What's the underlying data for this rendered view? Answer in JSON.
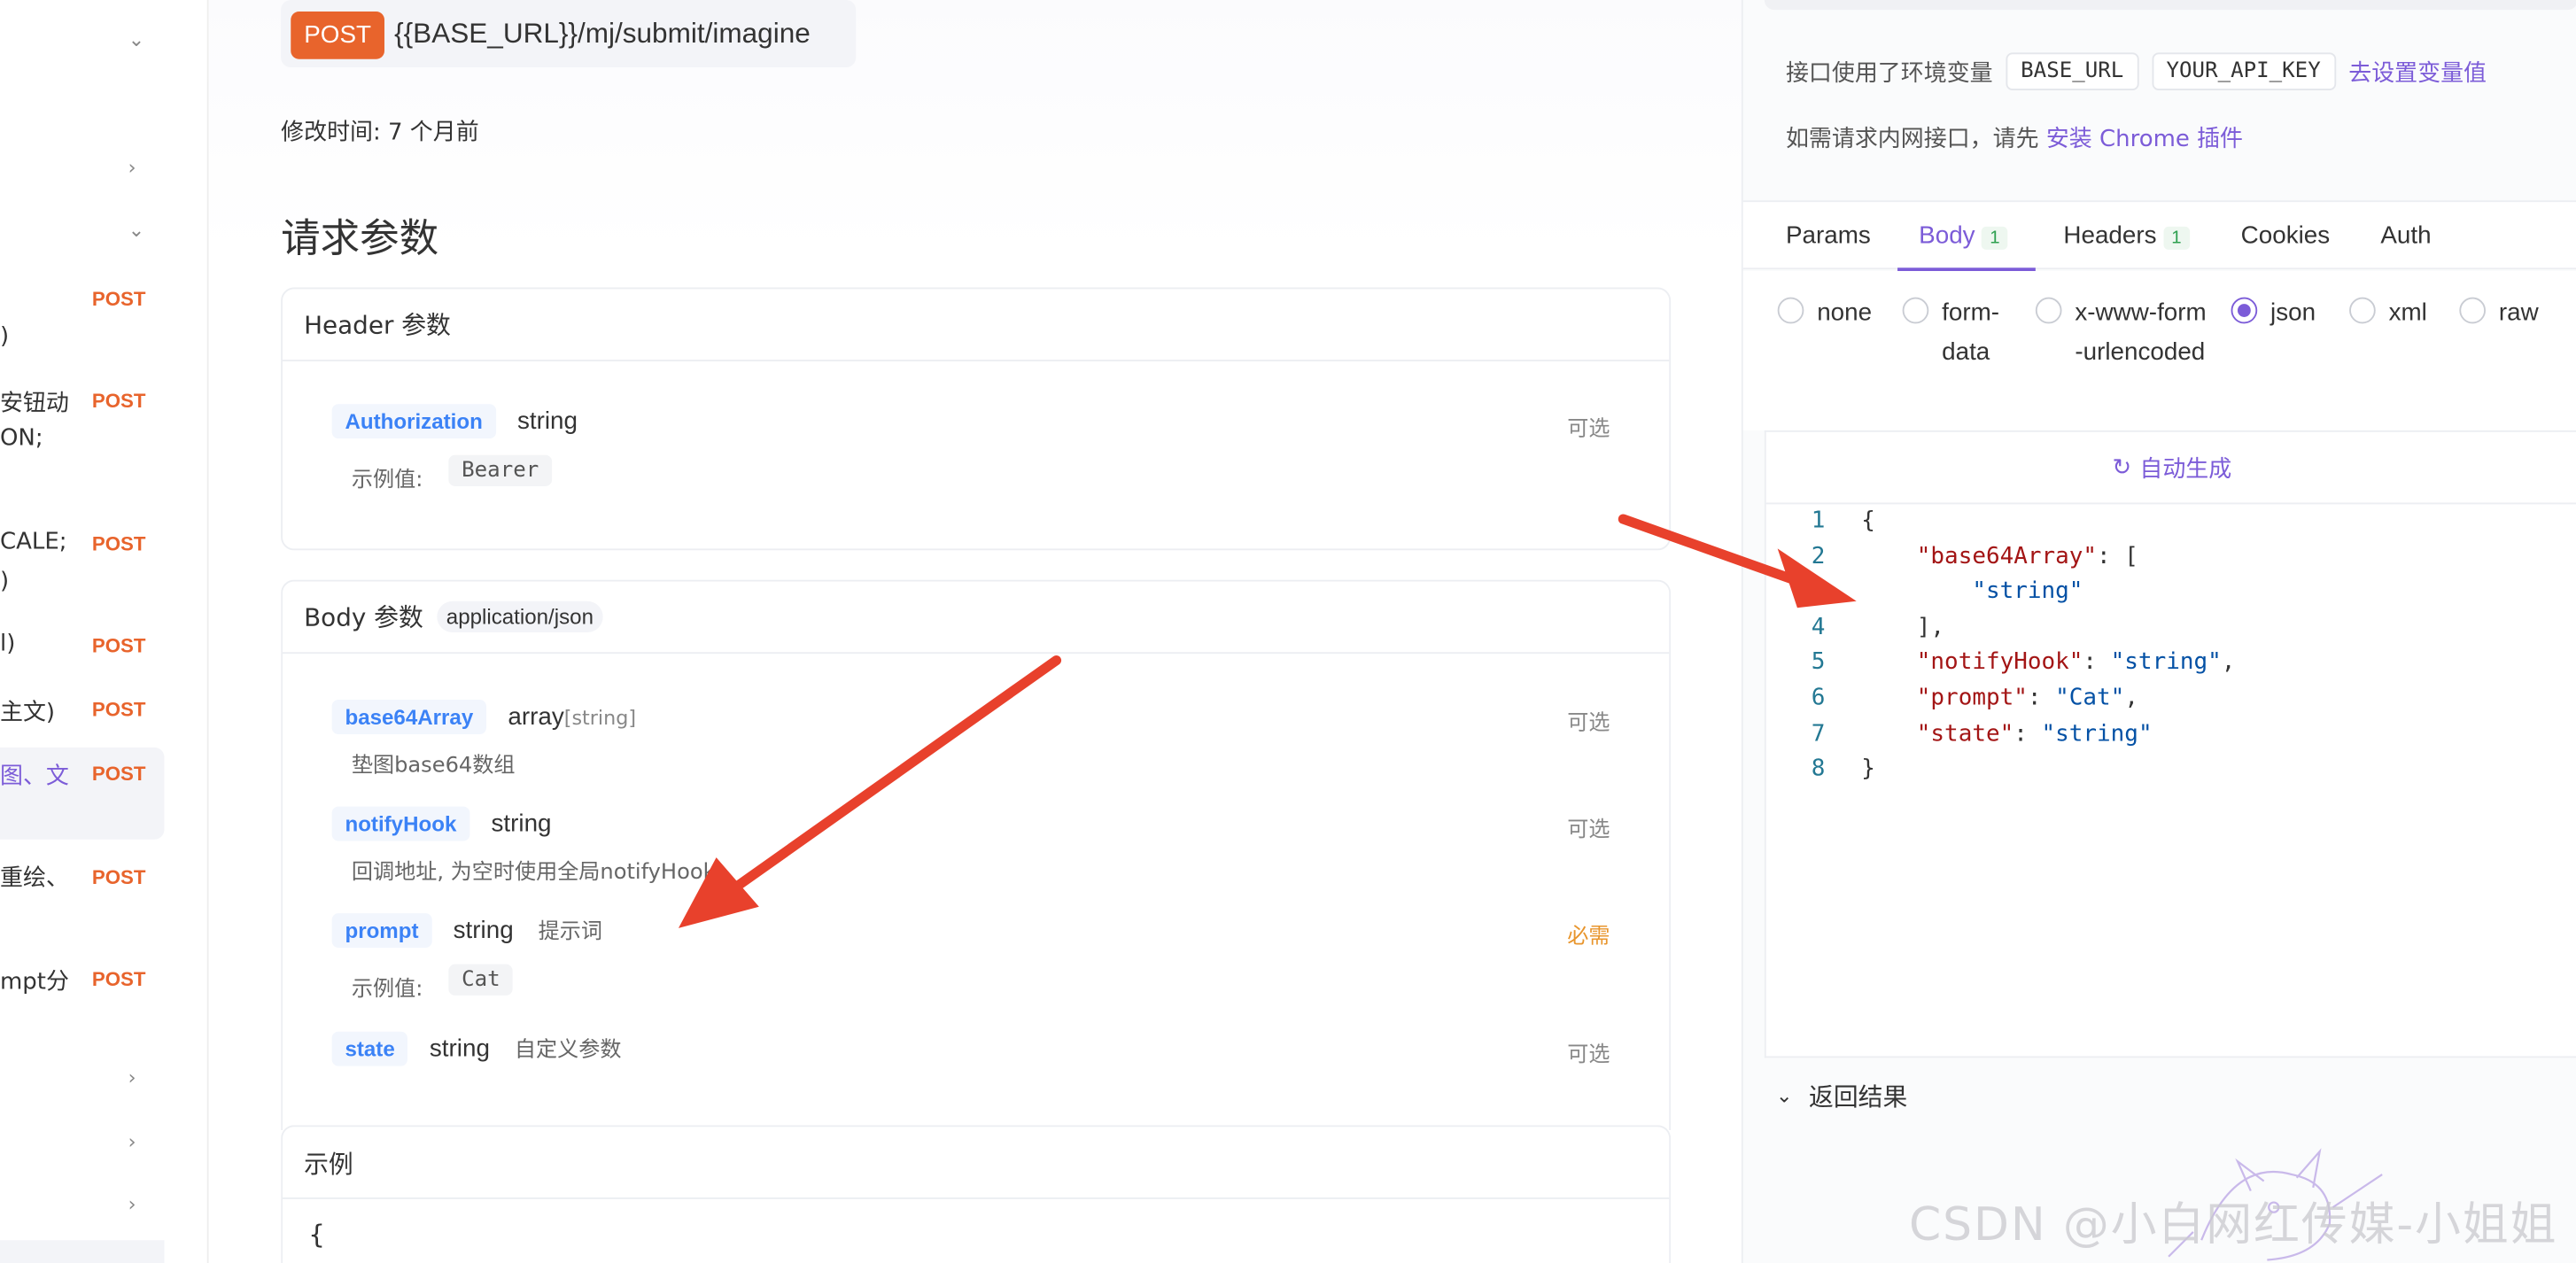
{
  "sidebar": {
    "rows": [
      {
        "text": "",
        "chevron": "⌄",
        "post": ""
      },
      {
        "text": "",
        "chevron": "›",
        "post": ""
      },
      {
        "text": "",
        "chevron": "⌄",
        "post": ""
      },
      {
        "text": ")",
        "post": "POST"
      },
      {
        "text": "安钮动",
        "text2": "ON;",
        "post": "POST"
      },
      {
        "text": "CALE;",
        "text2": ")",
        "post": "POST"
      },
      {
        "text": "l)",
        "post": "POST"
      },
      {
        "text": "主文)",
        "post": "POST"
      },
      {
        "text": "图、文",
        "post": "POST"
      },
      {
        "text": "重绘、",
        "post": "POST"
      },
      {
        "text": "mpt分",
        "post": "POST"
      },
      {
        "text": "",
        "chevron": "›"
      },
      {
        "text": "",
        "chevron": "›"
      },
      {
        "text": "",
        "chevron": "›"
      }
    ]
  },
  "request": {
    "method": "POST",
    "url": "{{BASE_URL}}/mj/submit/imagine",
    "modified_label": "修改时间: ",
    "modified_value": "7 个月前",
    "section_title": "请求参数"
  },
  "header_params": {
    "title": "Header 参数",
    "items": [
      {
        "name": "Authorization",
        "type": "string",
        "required": "可选",
        "example_label": "示例值:",
        "example": "Bearer"
      }
    ]
  },
  "body_params": {
    "title": "Body 参数",
    "content_type": "application/json",
    "items": [
      {
        "name": "base64Array",
        "type": "array",
        "subtype": "[string]",
        "note": "垫图base64数组",
        "required": "可选"
      },
      {
        "name": "notifyHook",
        "type": "string",
        "note": "回调地址, 为空时使用全局notifyHook",
        "required": "可选"
      },
      {
        "name": "prompt",
        "type": "string",
        "desc": "提示词",
        "example_label": "示例值:",
        "example": "Cat",
        "required": "必需"
      },
      {
        "name": "state",
        "type": "string",
        "desc": "自定义参数",
        "required": "可选"
      }
    ]
  },
  "example": {
    "title": "示例",
    "first_line": "{"
  },
  "right": {
    "env_prefix": "接口使用了环境变量",
    "env_vars": [
      "BASE_URL",
      "YOUR_API_KEY"
    ],
    "env_link": "去设置变量值",
    "intranet_prefix": "如需请求内网接口，请先 ",
    "intranet_link": "安装 Chrome 插件",
    "tabs": [
      {
        "label": "Params"
      },
      {
        "label": "Body",
        "count": "1"
      },
      {
        "label": "Headers",
        "count": "1"
      },
      {
        "label": "Cookies"
      },
      {
        "label": "Auth"
      }
    ],
    "body_types": [
      "none",
      "form-data",
      "x-www-form-urlencoded",
      "json",
      "xml",
      "raw"
    ],
    "body_type_selected": "json",
    "auto_generate": "自动生成",
    "code": [
      "{",
      "    \"base64Array\": [",
      "        \"string\"",
      "    ],",
      "    \"notifyHook\": \"string\",",
      "    \"prompt\": \"Cat\",",
      "    \"state\": \"string\"",
      "}"
    ],
    "result_label": "返回结果"
  },
  "watermark": "CSDN @小白网红传媒-小姐姐",
  "colors": {
    "accent": "#7c5cd8",
    "post": "#e8642c",
    "arrow": "#e8412c",
    "param_name": "#3b82f6"
  }
}
